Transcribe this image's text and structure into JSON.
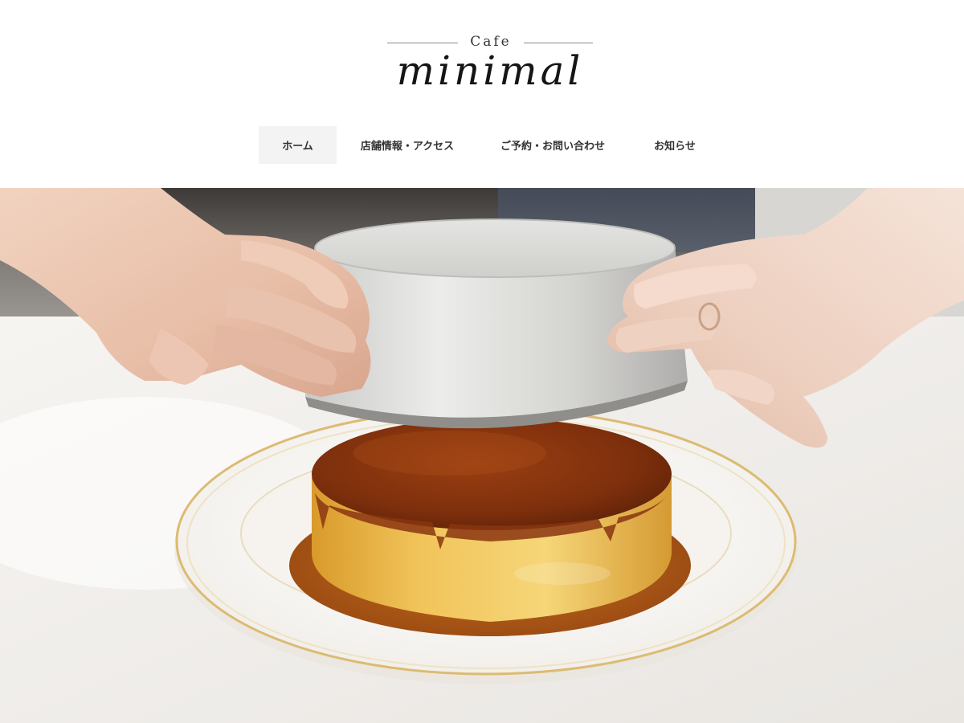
{
  "site": {
    "logo": {
      "top": "Cafe",
      "script": "minimal"
    }
  },
  "nav": {
    "items": [
      {
        "label": "ホーム",
        "active": true
      },
      {
        "label": "店舗情報・アクセス",
        "active": false
      },
      {
        "label": "ご予約・お問い合わせ",
        "active": false
      },
      {
        "label": "お知らせ",
        "active": false
      }
    ]
  },
  "hero": {
    "image": "pudding-being-unmolded-photo"
  },
  "colors": {
    "nav_active_bg": "#f3f3f3",
    "text": "#333333",
    "caramel": "#8a3a12",
    "custard": "#e8b440",
    "plate_rim": "#e2c27a"
  }
}
